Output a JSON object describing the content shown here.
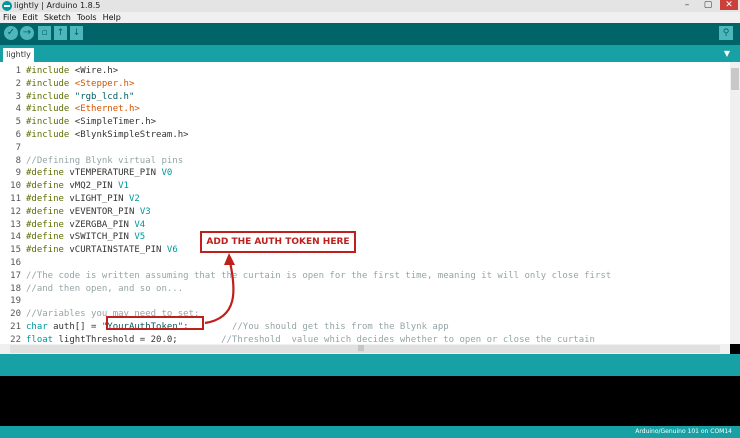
{
  "window": {
    "title": "lightly | Arduino 1.8.5",
    "controls": {
      "minimize": "–",
      "maximize": "▢",
      "close": "✕"
    }
  },
  "menu": [
    "File",
    "Edit",
    "Sketch",
    "Tools",
    "Help"
  ],
  "toolbar": {
    "verify_icon": "✓",
    "upload_icon": "→",
    "new_icon": "▫",
    "open_icon": "↑",
    "save_icon": "↓",
    "serial_icon": "⚲"
  },
  "tabs": [
    {
      "label": "lightly"
    }
  ],
  "tab_menu_icon": "▼",
  "lines": [
    {
      "n": "1",
      "segs": [
        [
          "pre",
          "#include "
        ],
        [
          "",
          "<Wire.h>"
        ]
      ]
    },
    {
      "n": "2",
      "segs": [
        [
          "pre",
          "#include "
        ],
        [
          "lib",
          "<Stepper.h>"
        ]
      ]
    },
    {
      "n": "3",
      "segs": [
        [
          "pre",
          "#include "
        ],
        [
          "str",
          "\"rgb_lcd.h\""
        ]
      ]
    },
    {
      "n": "4",
      "segs": [
        [
          "pre",
          "#include "
        ],
        [
          "lib",
          "<Ethernet.h>"
        ]
      ]
    },
    {
      "n": "5",
      "segs": [
        [
          "pre",
          "#include "
        ],
        [
          "",
          "<SimpleTimer.h>"
        ]
      ]
    },
    {
      "n": "6",
      "segs": [
        [
          "pre",
          "#include "
        ],
        [
          "",
          "<BlynkSimpleStream.h>"
        ]
      ]
    },
    {
      "n": "7",
      "segs": []
    },
    {
      "n": "8",
      "segs": [
        [
          "com",
          "//Defining Blynk virtual pins"
        ]
      ]
    },
    {
      "n": "9",
      "segs": [
        [
          "pre",
          "#define "
        ],
        [
          "",
          "vTEMPERATURE_PIN "
        ],
        [
          "num",
          "V0"
        ]
      ]
    },
    {
      "n": "10",
      "segs": [
        [
          "pre",
          "#define "
        ],
        [
          "",
          "vMQ2_PIN "
        ],
        [
          "num",
          "V1"
        ]
      ]
    },
    {
      "n": "11",
      "segs": [
        [
          "pre",
          "#define "
        ],
        [
          "",
          "vLIGHT_PIN "
        ],
        [
          "num",
          "V2"
        ]
      ]
    },
    {
      "n": "12",
      "segs": [
        [
          "pre",
          "#define "
        ],
        [
          "",
          "vEVENTOR_PIN "
        ],
        [
          "num",
          "V3"
        ]
      ]
    },
    {
      "n": "13",
      "segs": [
        [
          "pre",
          "#define "
        ],
        [
          "",
          "vZERGBA_PIN "
        ],
        [
          "num",
          "V4"
        ]
      ]
    },
    {
      "n": "14",
      "segs": [
        [
          "pre",
          "#define "
        ],
        [
          "",
          "vSWITCH_PIN "
        ],
        [
          "num",
          "V5"
        ]
      ]
    },
    {
      "n": "15",
      "segs": [
        [
          "pre",
          "#define "
        ],
        [
          "",
          "vCURTAINSTATE_PIN "
        ],
        [
          "num",
          "V6"
        ]
      ]
    },
    {
      "n": "16",
      "segs": []
    },
    {
      "n": "17",
      "segs": [
        [
          "com",
          "//The code is written assuming that the curtain is open for the first time, meaning it will only close first"
        ]
      ]
    },
    {
      "n": "18",
      "segs": [
        [
          "com",
          "//and then open, and so on..."
        ]
      ]
    },
    {
      "n": "19",
      "segs": []
    },
    {
      "n": "20",
      "segs": [
        [
          "com",
          "//Variables you may need to set:"
        ]
      ]
    },
    {
      "n": "21",
      "segs": [
        [
          "type",
          "char "
        ],
        [
          "",
          "auth[] = "
        ],
        [
          "str",
          "\"YourAuthToken\""
        ],
        [
          "",
          ";        "
        ],
        [
          "com",
          "//You should get this from the Blynk app"
        ]
      ]
    },
    {
      "n": "22",
      "segs": [
        [
          "type",
          "float "
        ],
        [
          "",
          "lightThreshold = 20.0;        "
        ],
        [
          "com",
          "//Threshold  value which decides whether to open or close the curtain"
        ]
      ]
    }
  ],
  "annotation": {
    "callout": "ADD THE AUTH TOKEN HERE",
    "color": "#c0201c"
  },
  "scroll_grip": "|||",
  "status": "Arduino/Genuino 101 on COM14",
  "colors": {
    "toolbar": "#006468",
    "tabbar": "#17a1a5",
    "accent": "#4db7bb"
  }
}
